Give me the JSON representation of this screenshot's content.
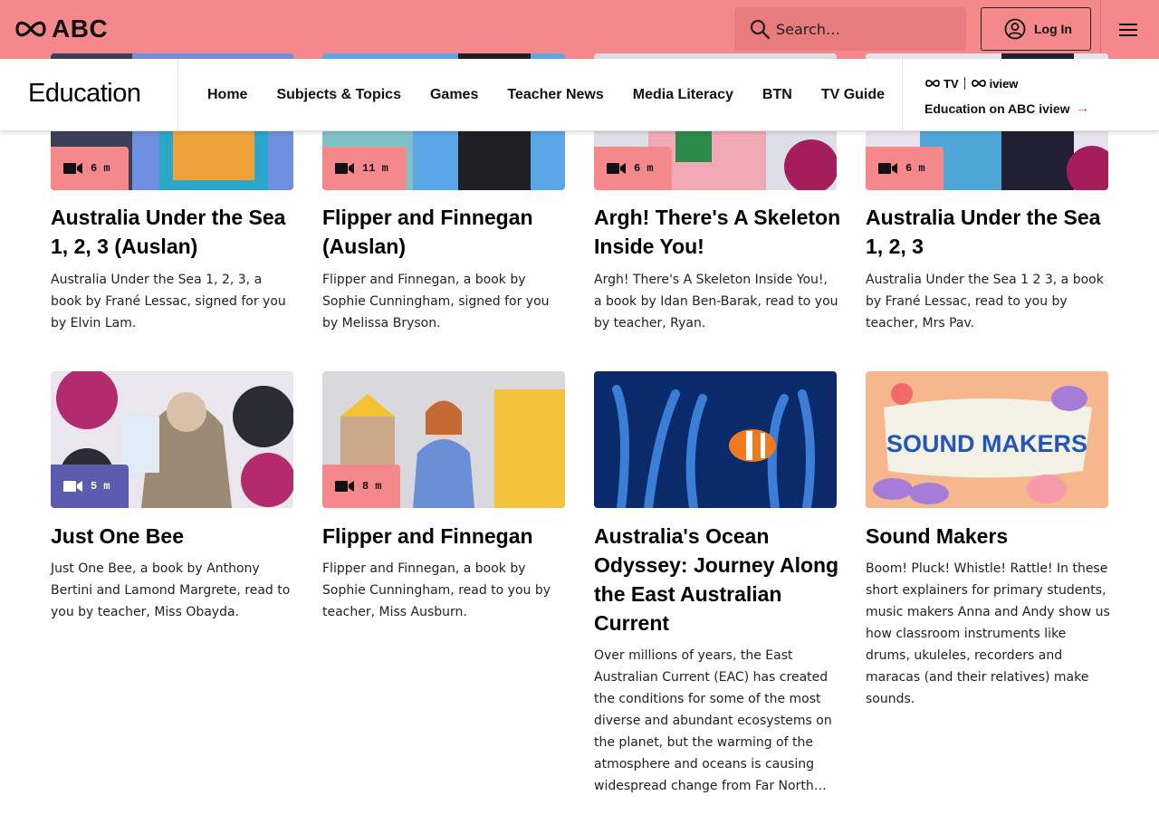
{
  "header": {
    "brand": "ABC",
    "search_placeholder": "Search…",
    "login_label": "Log In"
  },
  "subnav": {
    "title": "Education",
    "items": [
      "Home",
      "Subjects & Topics",
      "Games",
      "Teacher News",
      "Media Literacy",
      "BTN",
      "TV Guide"
    ],
    "iview_logo_tv": "TV",
    "iview_logo_iview": "iview",
    "iview_link": "Education on ABC iview",
    "iview_arrow": "→"
  },
  "colors": {
    "brand_pink": "#f4888b",
    "badge_pink": "#f4888b",
    "badge_purple": "#5b5bb0"
  },
  "cards": [
    {
      "duration": "6 m",
      "title": "Australia Under the Sea 1, 2, 3 (Auslan)",
      "description": "Australia Under the Sea 1, 2, 3, a book by Frané Lessac, signed for you by Elvin Lam.",
      "icon": "video-icon"
    },
    {
      "duration": "11 m",
      "title": "Flipper and Finnegan (Auslan)",
      "description": "Flipper and Finnegan, a book by Sophie Cunningham, signed for you by Melissa Bryson.",
      "icon": "video-icon"
    },
    {
      "duration": "6 m",
      "title": "Argh! There's A Skeleton Inside You!",
      "description": "Argh! There's A Skeleton Inside You!, a book by Idan Ben-Barak, read to you by teacher, Ryan.",
      "icon": "video-icon"
    },
    {
      "duration": "6 m",
      "title": "Australia Under the Sea 1, 2, 3",
      "description": "Australia Under the Sea 1 2 3, a book by Frané Lessac, read to you by teacher, Mrs Pav.",
      "icon": "video-icon"
    },
    {
      "duration": "5 m",
      "title": "Just One Bee",
      "description": "Just One Bee, a book by Anthony Bertini and Lamond Margrete, read to you by teacher, Miss Obayda.",
      "icon": "video-icon"
    },
    {
      "duration": "8 m",
      "title": "Flipper and Finnegan",
      "description": "Flipper and Finnegan, a book by Sophie Cunningham, read to you by teacher, Miss Ausburn.",
      "icon": "video-icon"
    },
    {
      "duration": "",
      "title": "Australia's Ocean Odyssey: Journey Along the East Australian Current",
      "description": "Over millions of years, the East Australian Current (EAC) has created the conditions for some of the most diverse and abundant ecosystems on the planet, but the warming of the atmosphere and oceans is causing widespread change from Far North…",
      "icon": ""
    },
    {
      "duration": "",
      "title": "Sound Makers",
      "description": "Boom! Pluck! Whistle! Rattle! In these short explainers for primary students, music makers Anna and Andy show us how classroom instruments like drums, ukuleles, recorders and maracas (and their relatives) make sounds.",
      "icon": "",
      "thumb_text": "SOUND MAKERS"
    }
  ]
}
